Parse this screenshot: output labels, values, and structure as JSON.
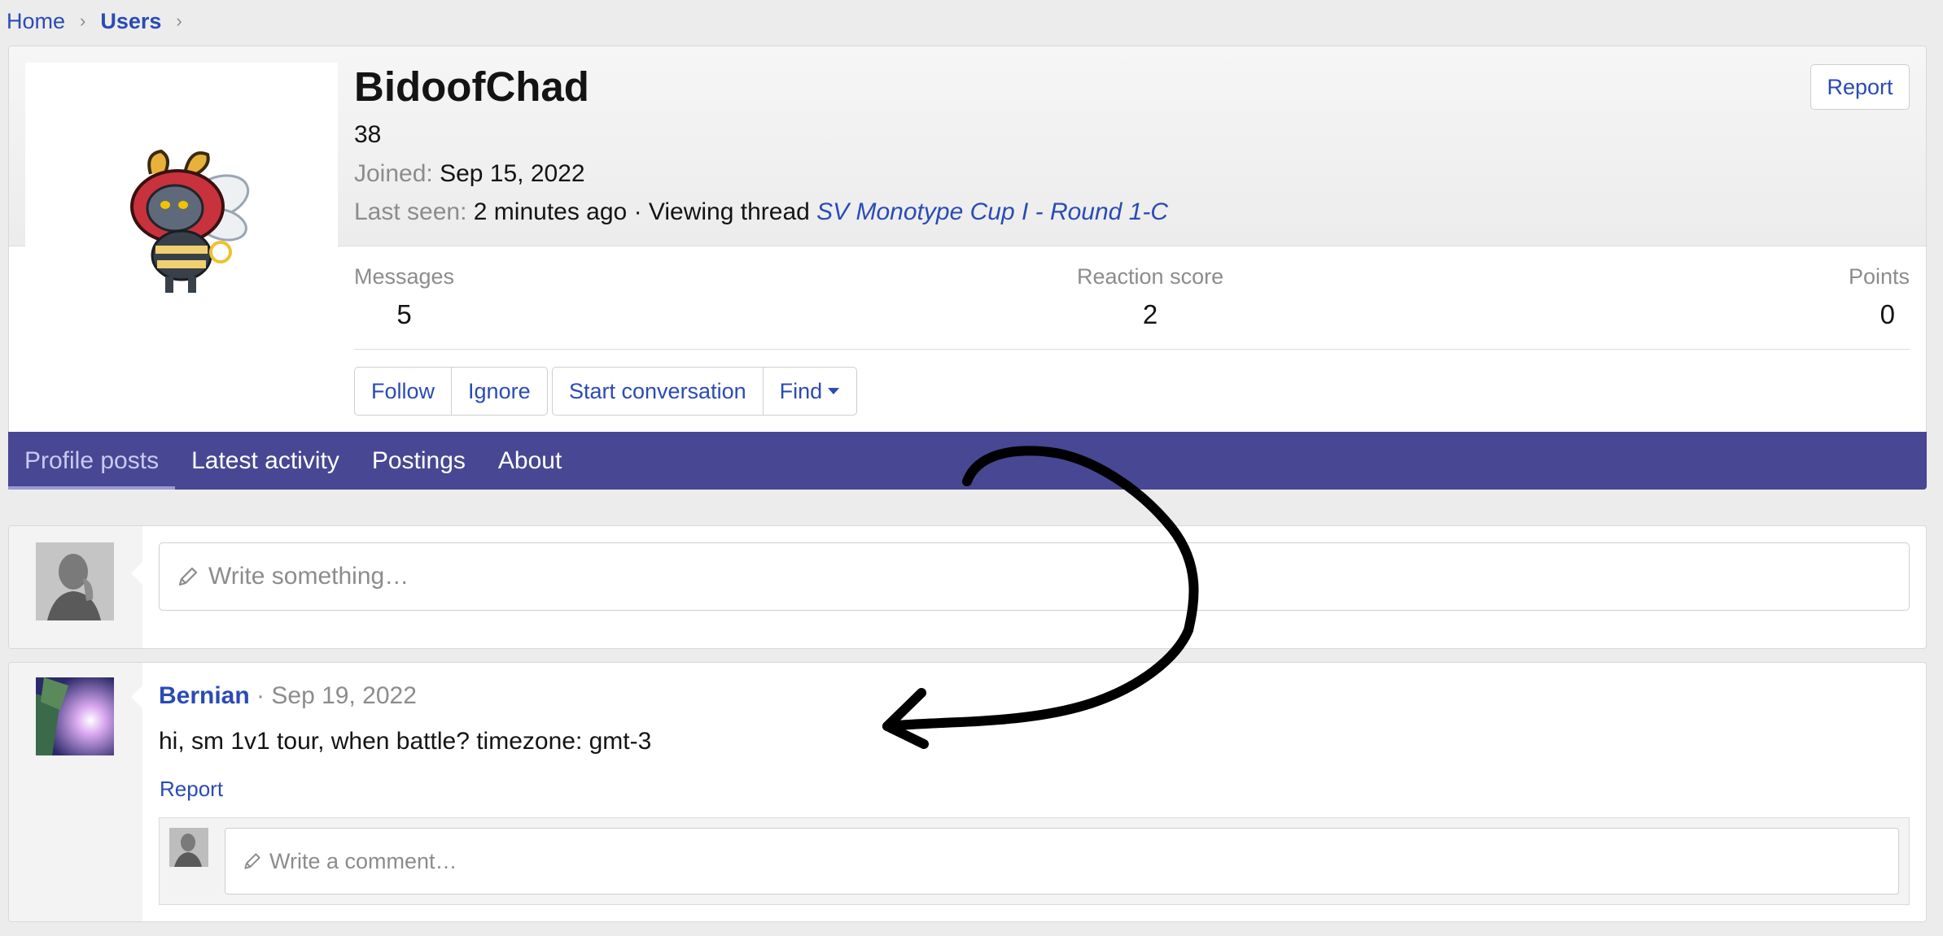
{
  "breadcrumb": {
    "home": "Home",
    "users": "Users"
  },
  "profile": {
    "username": "BidoofChad",
    "title": "38",
    "joined_label": "Joined:",
    "joined_value": "Sep 15, 2022",
    "last_seen_label": "Last seen:",
    "last_seen_value": "2 minutes ago · Viewing thread",
    "last_seen_thread": "SV Monotype Cup I - Round 1-C",
    "report_label": "Report"
  },
  "stats": {
    "messages_label": "Messages",
    "messages_value": "5",
    "reaction_label": "Reaction score",
    "reaction_value": "2",
    "points_label": "Points",
    "points_value": "0"
  },
  "actions": {
    "follow": "Follow",
    "ignore": "Ignore",
    "start_conversation": "Start conversation",
    "find": "Find"
  },
  "tabs": [
    {
      "label": "Profile posts"
    },
    {
      "label": "Latest activity"
    },
    {
      "label": "Postings"
    },
    {
      "label": "About"
    }
  ],
  "composer": {
    "placeholder": "Write something…"
  },
  "post": {
    "author": "Bernian",
    "separator": "·",
    "date": "Sep 19, 2022",
    "body": "hi, sm 1v1 tour, when battle? timezone: gmt-3",
    "report_label": "Report",
    "comment_placeholder": "Write a comment…"
  },
  "colors": {
    "link": "#2a4bb5",
    "tab_bar": "#474793",
    "annotation_stroke": "#000000"
  }
}
